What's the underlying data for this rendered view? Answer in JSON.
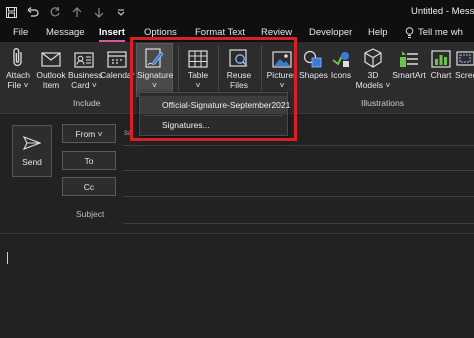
{
  "window": {
    "title": "Untitled - Messa"
  },
  "menu": {
    "tabs": [
      "File",
      "Message",
      "Insert",
      "Options",
      "Format Text",
      "Review",
      "Developer",
      "Help"
    ],
    "tell_me": "Tell me wh"
  },
  "ribbon": {
    "attach_file": [
      "Attach",
      "File ˅"
    ],
    "outlook_item": [
      "Outlook",
      "Item"
    ],
    "business_card": [
      "Business",
      "Card ˅"
    ],
    "calendar": [
      "Calendar"
    ],
    "signature": [
      "Signature",
      "˅"
    ],
    "table": [
      "Table",
      "˅"
    ],
    "reuse_files": [
      "Reuse",
      "Files"
    ],
    "pictures": [
      "Pictures",
      "˅"
    ],
    "shapes": [
      "Shapes"
    ],
    "icons": [
      "Icons"
    ],
    "models_3d": [
      "3D",
      "Models ˅"
    ],
    "smartart": [
      "SmartArt"
    ],
    "chart": [
      "Chart"
    ],
    "screenshot": [
      "Scree"
    ],
    "groups": {
      "include": "Include",
      "illustrations": "Illustrations"
    }
  },
  "dropdown": {
    "items": [
      "Official-Signature-September2021",
      "Signatures..."
    ]
  },
  "compose": {
    "send": "Send",
    "from": "From ˅",
    "from_address": "sa",
    "to": "To",
    "cc": "Cc",
    "subject": "Subject"
  }
}
